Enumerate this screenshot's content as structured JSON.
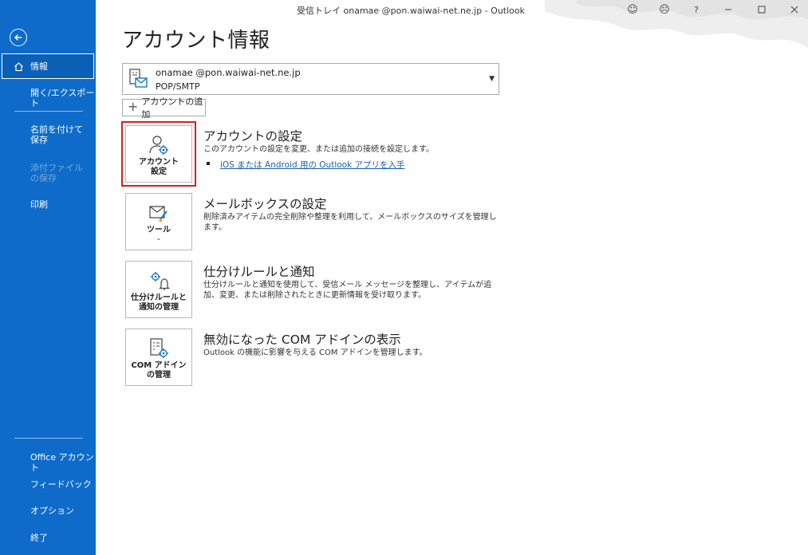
{
  "titlebar": {
    "title": "受信トレイ   onamae   @pon.waiwai-net.ne.jp  -  Outlook",
    "smile_label": "☺",
    "frown_label": "☹",
    "help_label": "?"
  },
  "sidebar": {
    "info": "情報",
    "open_export": "開く/エクスポート",
    "save_as": "名前を付けて保存",
    "save_attachments": "添付ファイルの保存",
    "print": "印刷",
    "office_account": "Office アカウント",
    "feedback": "フィードバック",
    "options": "オプション",
    "exit": "終了"
  },
  "main": {
    "page_title": "アカウント情報",
    "account": {
      "email": "onamae    @pon.waiwai-net.ne.jp",
      "type": "POP/SMTP"
    },
    "add_account": "アカウントの追加",
    "sections": [
      {
        "tile_label": "アカウント\n設定",
        "title": "アカウントの設定",
        "description": "このアカウントの設定を変更、または追加の接続を設定します。",
        "link": "iOS または Android 用の Outlook アプリを入手"
      },
      {
        "tile_label": "ツール",
        "title": "メールボックスの設定",
        "description": "削除済みアイテムの完全削除や整理を利用して、メールボックスのサイズを管理します。"
      },
      {
        "tile_label": "仕分けルールと\n通知の管理",
        "title": "仕分けルールと通知",
        "description": "仕分けルールと通知を使用して、受信メール メッセージを整理し、アイテムが追加、変更、または削除されたときに更新情報を受け取ります。"
      },
      {
        "tile_label": "COM アドイン\nの管理",
        "title": "無効になった COM アドインの表示",
        "description": "Outlook の機能に影響を与える COM アドインを管理します。"
      }
    ]
  },
  "colors": {
    "sidebar": "#0e6bc9",
    "highlight": "#d42020",
    "link": "#1a5fb4"
  }
}
